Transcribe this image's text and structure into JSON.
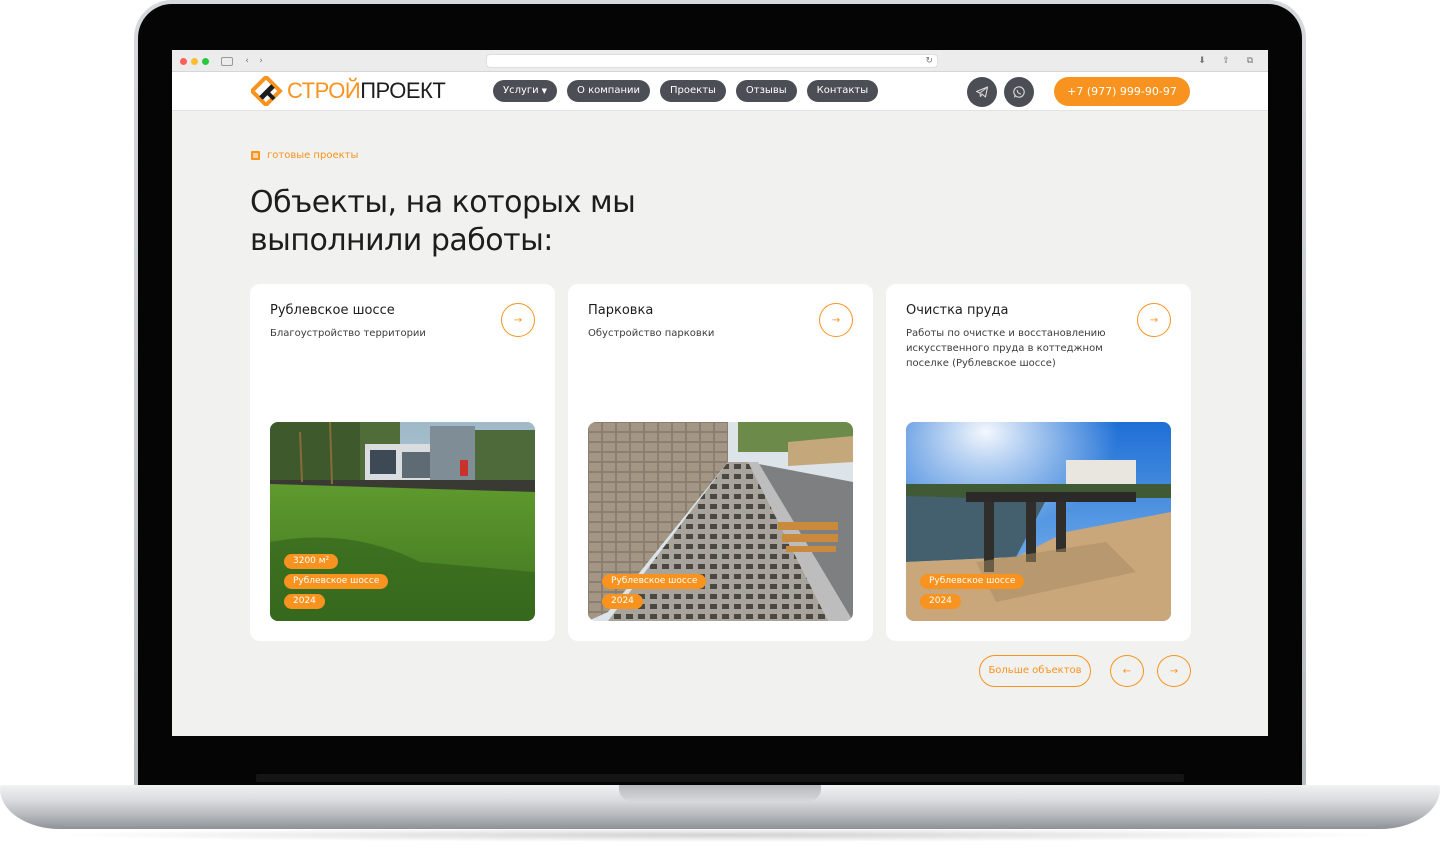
{
  "brand": {
    "name_part1": "СТРОЙ",
    "name_part2": "ПРОЕКТ",
    "accent_color": "#f7931e",
    "dark_color": "#4b4f55"
  },
  "nav": {
    "items": [
      {
        "label": "Услуги",
        "has_dropdown": true
      },
      {
        "label": "О компании"
      },
      {
        "label": "Проекты"
      },
      {
        "label": "Отзывы"
      },
      {
        "label": "Контакты"
      }
    ],
    "telegram_icon": "telegram-icon",
    "whatsapp_icon": "whatsapp-icon",
    "phone": "+7 (977) 999-90-97"
  },
  "section": {
    "tag": "готовые проекты",
    "headline_line1": "Объекты, на которых мы",
    "headline_line2": "выполнили работы:"
  },
  "cards": [
    {
      "title": "Рублевское шоссе",
      "description": "Благоустройство территории",
      "chips": [
        "3200 м²",
        "Рублевское шоссе",
        "2024"
      ]
    },
    {
      "title": "Парковка",
      "description": "Обустройство парковки",
      "chips": [
        "Рублевское шоссе",
        "2024"
      ]
    },
    {
      "title": "Очистка пруда",
      "description": "Работы по очистке и восстановлению искусственного пруда в коттеджном поселке (Рублевское шоссе)",
      "chips": [
        "Рублевское шоссе",
        "2024"
      ]
    }
  ],
  "controls": {
    "more_label": "Больше объектов",
    "prev_icon": "arrow-left-icon",
    "next_icon": "arrow-right-icon",
    "card_arrow_glyph": "→",
    "prev_glyph": "←",
    "next_glyph": "→"
  }
}
